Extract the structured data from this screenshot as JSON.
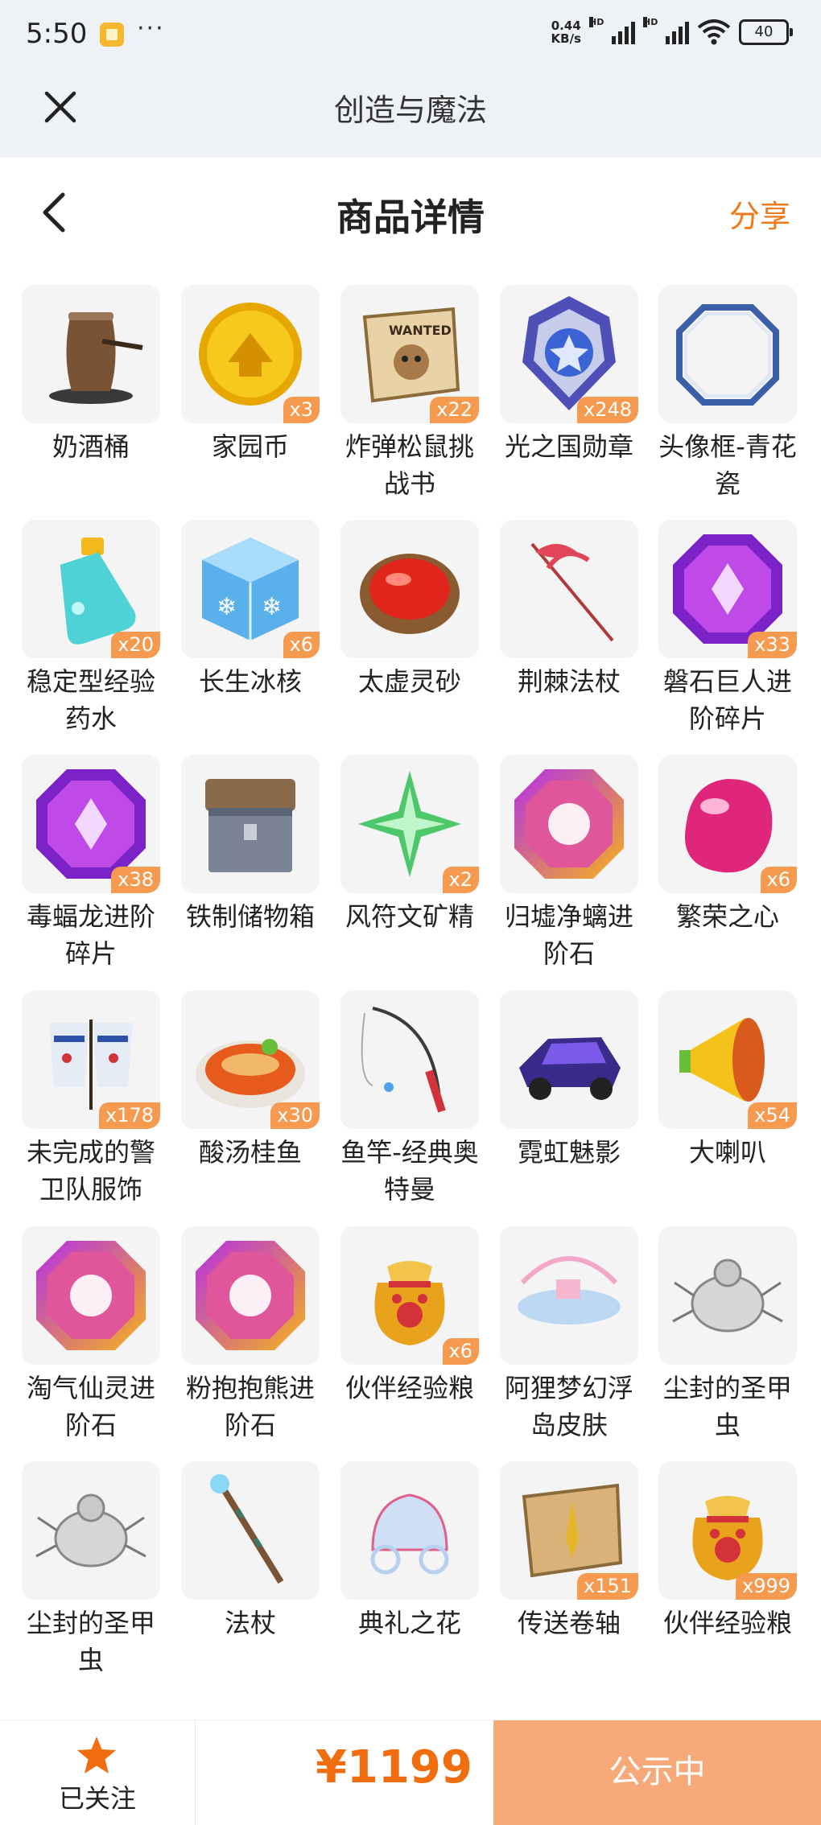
{
  "status_bar": {
    "time": "5:50",
    "net_speed_value": "0.44",
    "net_speed_unit": "KB/s",
    "hd_label": "HD",
    "battery": "40"
  },
  "title_bar": {
    "title": "创造与魔法"
  },
  "nav": {
    "title": "商品详情",
    "share_label": "分享"
  },
  "items": [
    {
      "name": "奶酒桶",
      "count": "",
      "icon": "milk-wine-barrel-icon"
    },
    {
      "name": "家园币",
      "count": "x3",
      "icon": "home-coin-icon"
    },
    {
      "name": "炸弹松鼠挑战书",
      "count": "x22",
      "icon": "wanted-scroll-icon"
    },
    {
      "name": "光之国勋章",
      "count": "x248",
      "icon": "medal-icon"
    },
    {
      "name": "头像框-青花瓷",
      "count": "",
      "icon": "avatar-frame-icon"
    },
    {
      "name": "稳定型经验药水",
      "count": "x20",
      "icon": "potion-icon"
    },
    {
      "name": "长生冰核",
      "count": "x6",
      "icon": "ice-cube-icon"
    },
    {
      "name": "太虚灵砂",
      "count": "",
      "icon": "red-bowl-icon"
    },
    {
      "name": "荆棘法杖",
      "count": "",
      "icon": "thorn-staff-icon"
    },
    {
      "name": "磐石巨人进阶碎片",
      "count": "x33",
      "icon": "purple-gem-icon"
    },
    {
      "name": "毒蝠龙进阶碎片",
      "count": "x38",
      "icon": "purple-gem-icon"
    },
    {
      "name": "铁制储物箱",
      "count": "",
      "icon": "storage-chest-icon"
    },
    {
      "name": "风符文矿精",
      "count": "x2",
      "icon": "green-crystal-icon"
    },
    {
      "name": "归墟净螭进阶石",
      "count": "",
      "icon": "gradient-gem-icon"
    },
    {
      "name": "繁荣之心",
      "count": "x6",
      "icon": "pink-heart-stone-icon"
    },
    {
      "name": "未完成的警卫队服饰",
      "count": "x178",
      "icon": "costume-icon"
    },
    {
      "name": "酸汤桂鱼",
      "count": "x30",
      "icon": "fish-soup-icon"
    },
    {
      "name": "鱼竿-经典奥特曼",
      "count": "",
      "icon": "fishing-rod-icon"
    },
    {
      "name": "霓虹魅影",
      "count": "",
      "icon": "neon-car-icon"
    },
    {
      "name": "大喇叭",
      "count": "x54",
      "icon": "megaphone-icon"
    },
    {
      "name": "淘气仙灵进阶石",
      "count": "",
      "icon": "gradient-gem-icon"
    },
    {
      "name": "粉抱抱熊进阶石",
      "count": "",
      "icon": "gradient-gem-icon"
    },
    {
      "name": "伙伴经验粮",
      "count": "x6",
      "icon": "paw-bag-icon"
    },
    {
      "name": "阿狸梦幻浮岛皮肤",
      "count": "",
      "icon": "floating-island-icon"
    },
    {
      "name": "尘封的圣甲虫",
      "count": "",
      "icon": "scarab-icon"
    },
    {
      "name": "尘封的圣甲虫",
      "count": "",
      "icon": "scarab-icon"
    },
    {
      "name": "法杖",
      "count": "",
      "icon": "staff-icon"
    },
    {
      "name": "典礼之花",
      "count": "",
      "icon": "carriage-icon"
    },
    {
      "name": "传送卷轴",
      "count": "x151",
      "icon": "teleport-scroll-icon"
    },
    {
      "name": "伙伴经验粮",
      "count": "x999",
      "icon": "paw-bag-icon"
    }
  ],
  "bottom_bar": {
    "follow_label": "已关注",
    "price": "¥1199",
    "status_label": "公示中"
  },
  "colors": {
    "accent": "#f07a17",
    "badge": "#f59a4f",
    "status_button": "#f8a97a"
  }
}
